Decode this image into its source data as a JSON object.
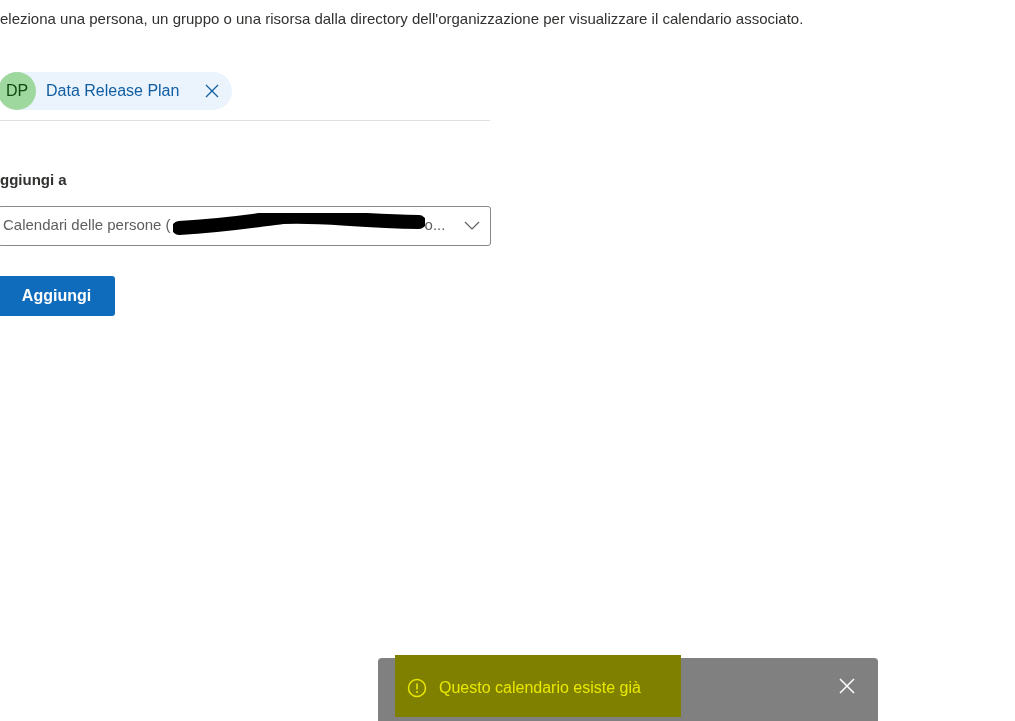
{
  "instruction": "eleziona una persona, un gruppo o una risorsa dalla directory dell'organizzazione per visualizzare il calendario associato.",
  "selected_person": {
    "initials": "DP",
    "name": "Data Release Plan"
  },
  "add_to": {
    "label": "ggiungi a",
    "value": "Calendari delle persone (",
    "value_end": "o..."
  },
  "add_button": "Aggiungi",
  "toast": {
    "kind": "warning",
    "message": "Questo calendario esiste già"
  }
}
